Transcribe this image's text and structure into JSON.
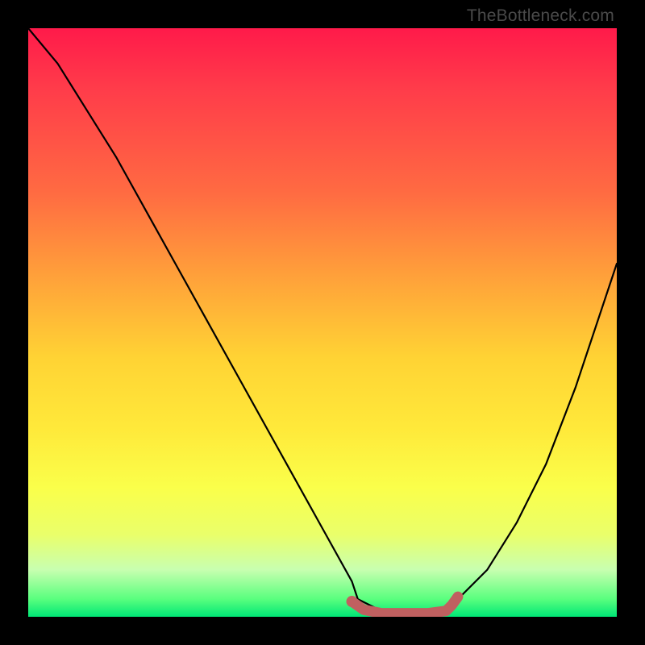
{
  "attribution": "TheBottleneck.com",
  "chart_data": {
    "type": "line",
    "title": "",
    "xlabel": "",
    "ylabel": "",
    "xlim": [
      0,
      100
    ],
    "ylim": [
      0,
      100
    ],
    "grid": false,
    "series": [
      {
        "name": "bottleneck-curve",
        "color": "#000000",
        "x": [
          0,
          5,
          10,
          15,
          20,
          25,
          30,
          35,
          40,
          45,
          50,
          55,
          56,
          60,
          65,
          70,
          73,
          78,
          83,
          88,
          93,
          98,
          100
        ],
        "values": [
          100,
          94,
          86,
          78,
          69,
          60,
          51,
          42,
          33,
          24,
          15,
          6,
          3,
          1,
          1,
          1,
          3,
          8,
          16,
          26,
          39,
          54,
          60
        ]
      },
      {
        "name": "optimal-range-marker",
        "color": "#c06060",
        "x": [
          55,
          57,
          60,
          64,
          68,
          71,
          72,
          73
        ],
        "values": [
          2.6,
          1.2,
          0.6,
          0.6,
          0.6,
          1.0,
          2.0,
          3.4
        ]
      }
    ],
    "annotations": [
      {
        "type": "point",
        "name": "optimal-start-dot",
        "x": 55,
        "y": 2.6,
        "color": "#c06060",
        "radius": 7
      }
    ]
  }
}
